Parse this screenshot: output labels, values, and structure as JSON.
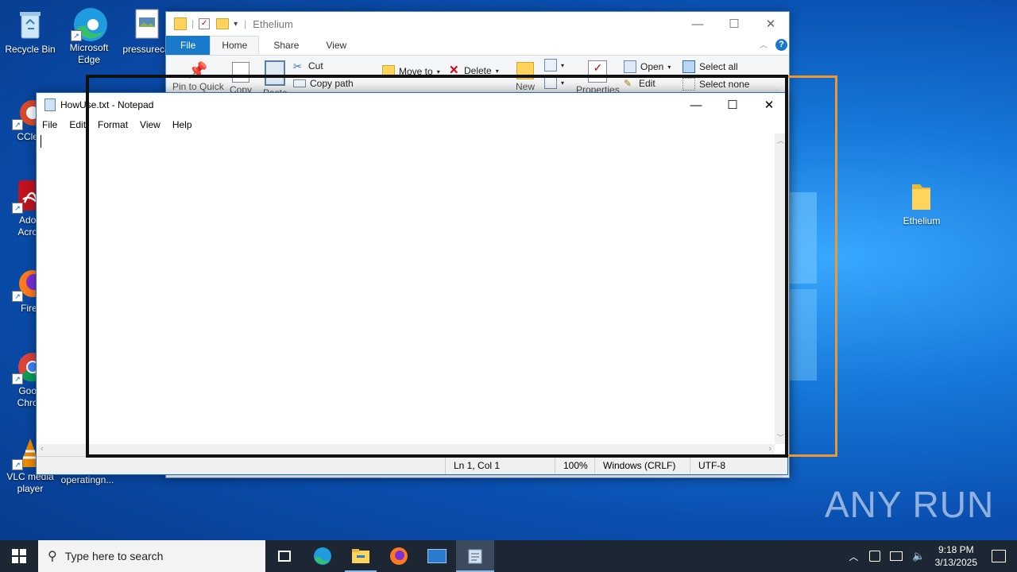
{
  "desktop": {
    "icons": [
      {
        "label": "Recycle Bin"
      },
      {
        "label": "Microsoft Edge"
      },
      {
        "label": "pressureca"
      },
      {
        "label": "CClea"
      },
      {
        "label": "Adob Acrob"
      },
      {
        "label": "Firef"
      },
      {
        "label": "Goog Chron"
      },
      {
        "label": "VLC media player"
      },
      {
        "label": "operatingn..."
      },
      {
        "label": "Ethelium"
      }
    ]
  },
  "explorer": {
    "title": "Ethelium",
    "tabs": [
      "File",
      "Home",
      "Share",
      "View"
    ],
    "ribbon": {
      "cut": "Cut",
      "copy_path": "Copy path",
      "pin": "Pin to Quick",
      "copy": "Copy",
      "paste": "Paste",
      "move_to": "Move to",
      "delete": "Delete",
      "new": "New",
      "properties": "Properties",
      "open": "Open",
      "edit": "Edit",
      "select_all": "Select all",
      "select_none": "Select none"
    }
  },
  "notepad": {
    "title": "HowUse.txt - Notepad",
    "menu": [
      "File",
      "Edit",
      "Format",
      "View",
      "Help"
    ],
    "status": {
      "position": "Ln 1, Col 1",
      "zoom": "100%",
      "line_ending": "Windows (CRLF)",
      "encoding": "UTF-8"
    }
  },
  "taskbar": {
    "search_placeholder": "Type here to search",
    "time": "9:18 PM",
    "date": "3/13/2025"
  },
  "watermark": "ANY RUN",
  "colors": {
    "accent": "#1979ca",
    "highlight_orange": "#f0962f"
  }
}
